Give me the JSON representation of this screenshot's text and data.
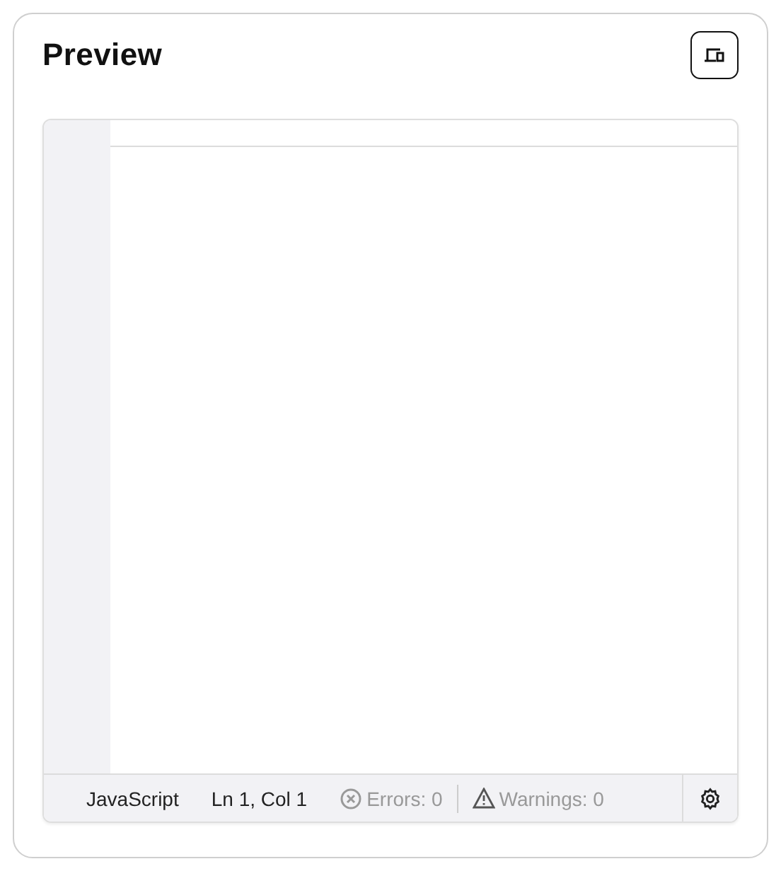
{
  "title": "Preview",
  "status_bar": {
    "language": "JavaScript",
    "position": "Ln 1, Col 1",
    "errors": "Errors: 0",
    "warnings": "Warnings: 0"
  }
}
